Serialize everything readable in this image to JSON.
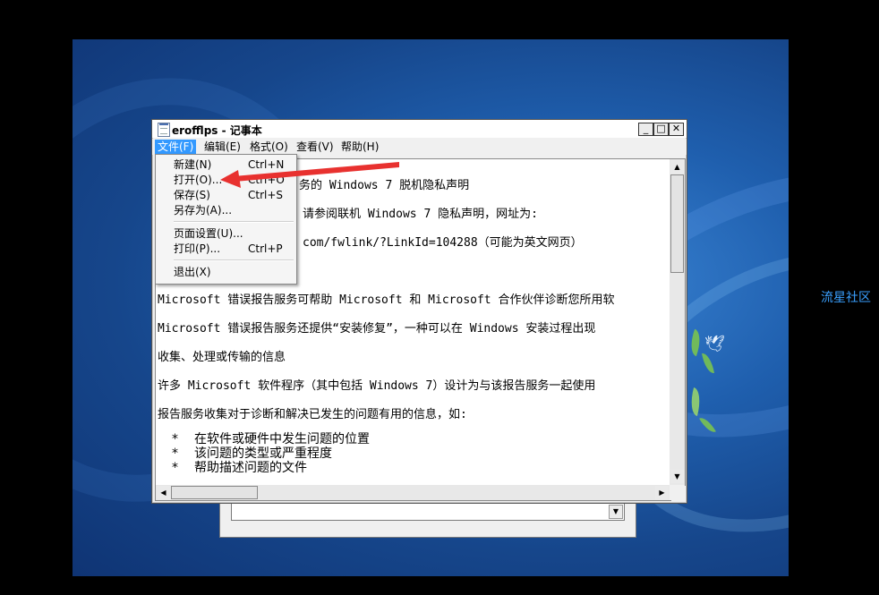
{
  "watermark": "流星社区",
  "window": {
    "title": "erofflps - 记事本",
    "buttons": {
      "minimize": "_",
      "maximize": "□",
      "close": "✕"
    }
  },
  "menubar": {
    "items": [
      {
        "label": "文件(F)"
      },
      {
        "label": "编辑(E)"
      },
      {
        "label": "格式(O)"
      },
      {
        "label": "查看(V)"
      },
      {
        "label": "帮助(H)"
      }
    ]
  },
  "file_menu": {
    "items": [
      {
        "label": "新建(N)",
        "shortcut": "Ctrl+N"
      },
      {
        "label": "打开(O)...",
        "shortcut": "Ctrl+O"
      },
      {
        "label": "保存(S)",
        "shortcut": "Ctrl+S"
      },
      {
        "label": "另存为(A)...",
        "shortcut": ""
      },
      {
        "label": "页面设置(U)...",
        "shortcut": ""
      },
      {
        "label": "打印(P)...",
        "shortcut": "Ctrl+P"
      },
      {
        "label": "退出(X)",
        "shortcut": ""
      }
    ]
  },
  "document": {
    "lines": [
      "务的 Windows 7 脱机隐私声明",
      "请参阅联机 Windows 7 隐私声明，网址为:",
      "com/fwlink/?LinkId=104288（可能为英文网页）",
      "",
      "Microsoft 错误报告服务可帮助 Microsoft 和 Microsoft 合作伙伴诊断您所用软",
      "Microsoft 错误报告服务还提供“安装修复”，一种可以在 Windows 安装过程出现",
      "收集、处理或传输的信息",
      "许多 Microsoft 软件程序（其中包括 Windows 7）设计为与该报告服务一起使用",
      "报告服务收集对于诊断和解决已发生的问题有用的信息，如:"
    ],
    "bullets": [
      "在软件或硬件中发生问题的位置",
      "该问题的类型或严重程度",
      "帮助描述问题的文件"
    ],
    "bullet_mark": "*"
  },
  "colors": {
    "menu_highlight": "#3399ff",
    "annotation_arrow": "#e8312f"
  }
}
